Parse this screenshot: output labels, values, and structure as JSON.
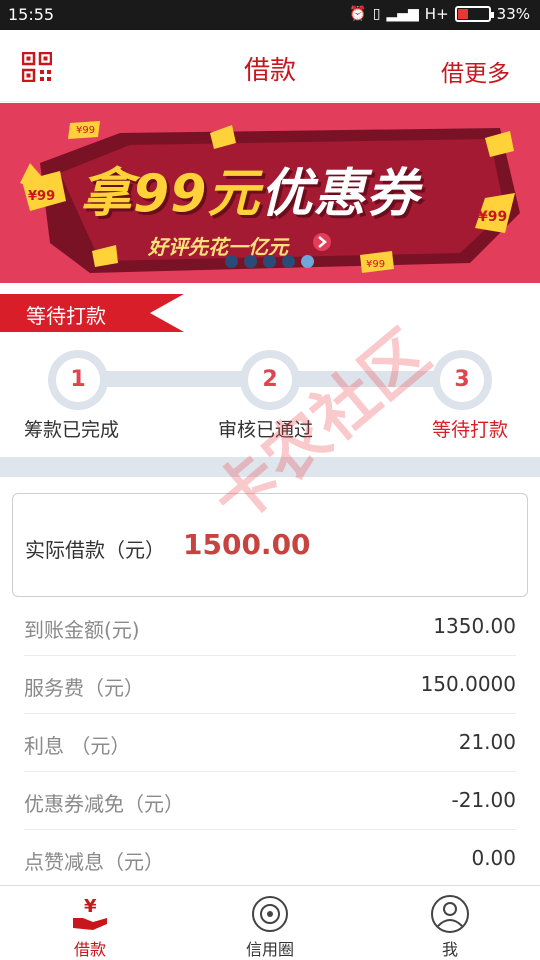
{
  "status_bar": {
    "time": "15:55",
    "network": "H+",
    "battery": "33%",
    "battery_level": 0.33
  },
  "header": {
    "title": "借款",
    "more": "借更多"
  },
  "banner": {
    "headline_prefix": "拿",
    "headline_number": "99元",
    "headline_suffix": "优惠券",
    "subtitle": "好评先花一亿元",
    "coupon_label": "¥99",
    "page_count": 5,
    "active_page": 5
  },
  "stage": {
    "label": "等待打款"
  },
  "steps": [
    {
      "num": "1",
      "label": "筹款已完成"
    },
    {
      "num": "2",
      "label": "审核已通过"
    },
    {
      "num": "3",
      "label": "等待打款"
    }
  ],
  "loan": {
    "label": "实际借款（元）",
    "value": "1500.00"
  },
  "details": [
    {
      "label": "到账金额(元)",
      "value": "1350.00"
    },
    {
      "label": "服务费（元）",
      "value": "150.0000"
    },
    {
      "label": "利息  （元）",
      "value": "21.00"
    },
    {
      "label": "优惠券减免（元）",
      "value": "-21.00"
    },
    {
      "label": "点赞减息（元）",
      "value": "0.00"
    }
  ],
  "watermark": "卡农社区",
  "tabs": [
    {
      "label": "借款",
      "icon": "yen-hand-icon"
    },
    {
      "label": "信用圈",
      "icon": "credit-circle-icon"
    },
    {
      "label": "我",
      "icon": "user-icon"
    }
  ],
  "colors": {
    "brand": "#c8161d",
    "banner_bg": "#e23d5a",
    "accent_yellow": "#ffd23a",
    "band": "#dfe5ec"
  }
}
